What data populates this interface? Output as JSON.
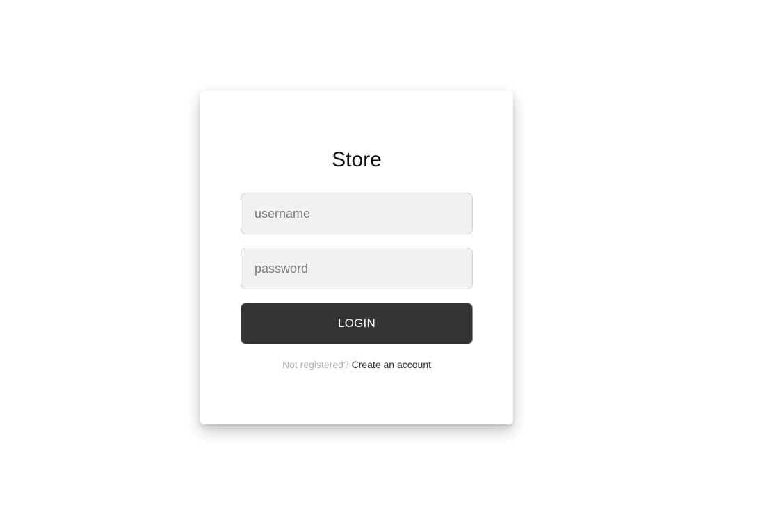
{
  "login_form": {
    "title": "Store",
    "username_placeholder": "username",
    "username_value": "",
    "password_placeholder": "password",
    "password_value": "",
    "login_label": "LOGIN",
    "register_prompt": "Not registered?",
    "register_link": "Create an account"
  },
  "colors": {
    "page_background": "#ffffff",
    "card_background": "#ffffff",
    "input_background": "#f1f1f1",
    "button_background": "#333436",
    "button_text": "#ffffff",
    "muted_text": "#b3b3b3"
  }
}
